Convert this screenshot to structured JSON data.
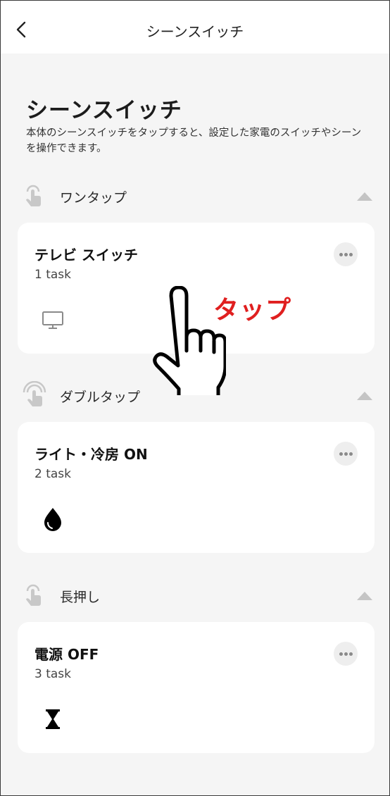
{
  "nav": {
    "title": "シーンスイッチ",
    "back_icon": "chevron-left-icon"
  },
  "header": {
    "title": "シーンスイッチ",
    "description": "本体のシーンスイッチをタップすると、設定した家電のスイッチやシーンを操作できます。"
  },
  "sections": [
    {
      "label": "ワンタップ",
      "icon": "single-tap-icon",
      "card": {
        "title": "テレビ スイッチ",
        "subtitle": "1 task",
        "icon": "tv-icon"
      }
    },
    {
      "label": "ダブルタップ",
      "icon": "double-tap-icon",
      "card": {
        "title": "ライト・冷房 ON",
        "subtitle": "2 task",
        "icon": "water-drop-icon"
      }
    },
    {
      "label": "長押し",
      "icon": "long-press-icon",
      "card": {
        "title": "電源 OFF",
        "subtitle": "3 task",
        "icon": "hourglass-icon"
      }
    }
  ],
  "annotation": {
    "text": "タップ",
    "color": "#e01f1f",
    "icon": "pointing-hand-icon"
  },
  "colors": {
    "background": "#f5f5f5",
    "card": "#ffffff",
    "muted_icon": "#c8c8c8"
  }
}
